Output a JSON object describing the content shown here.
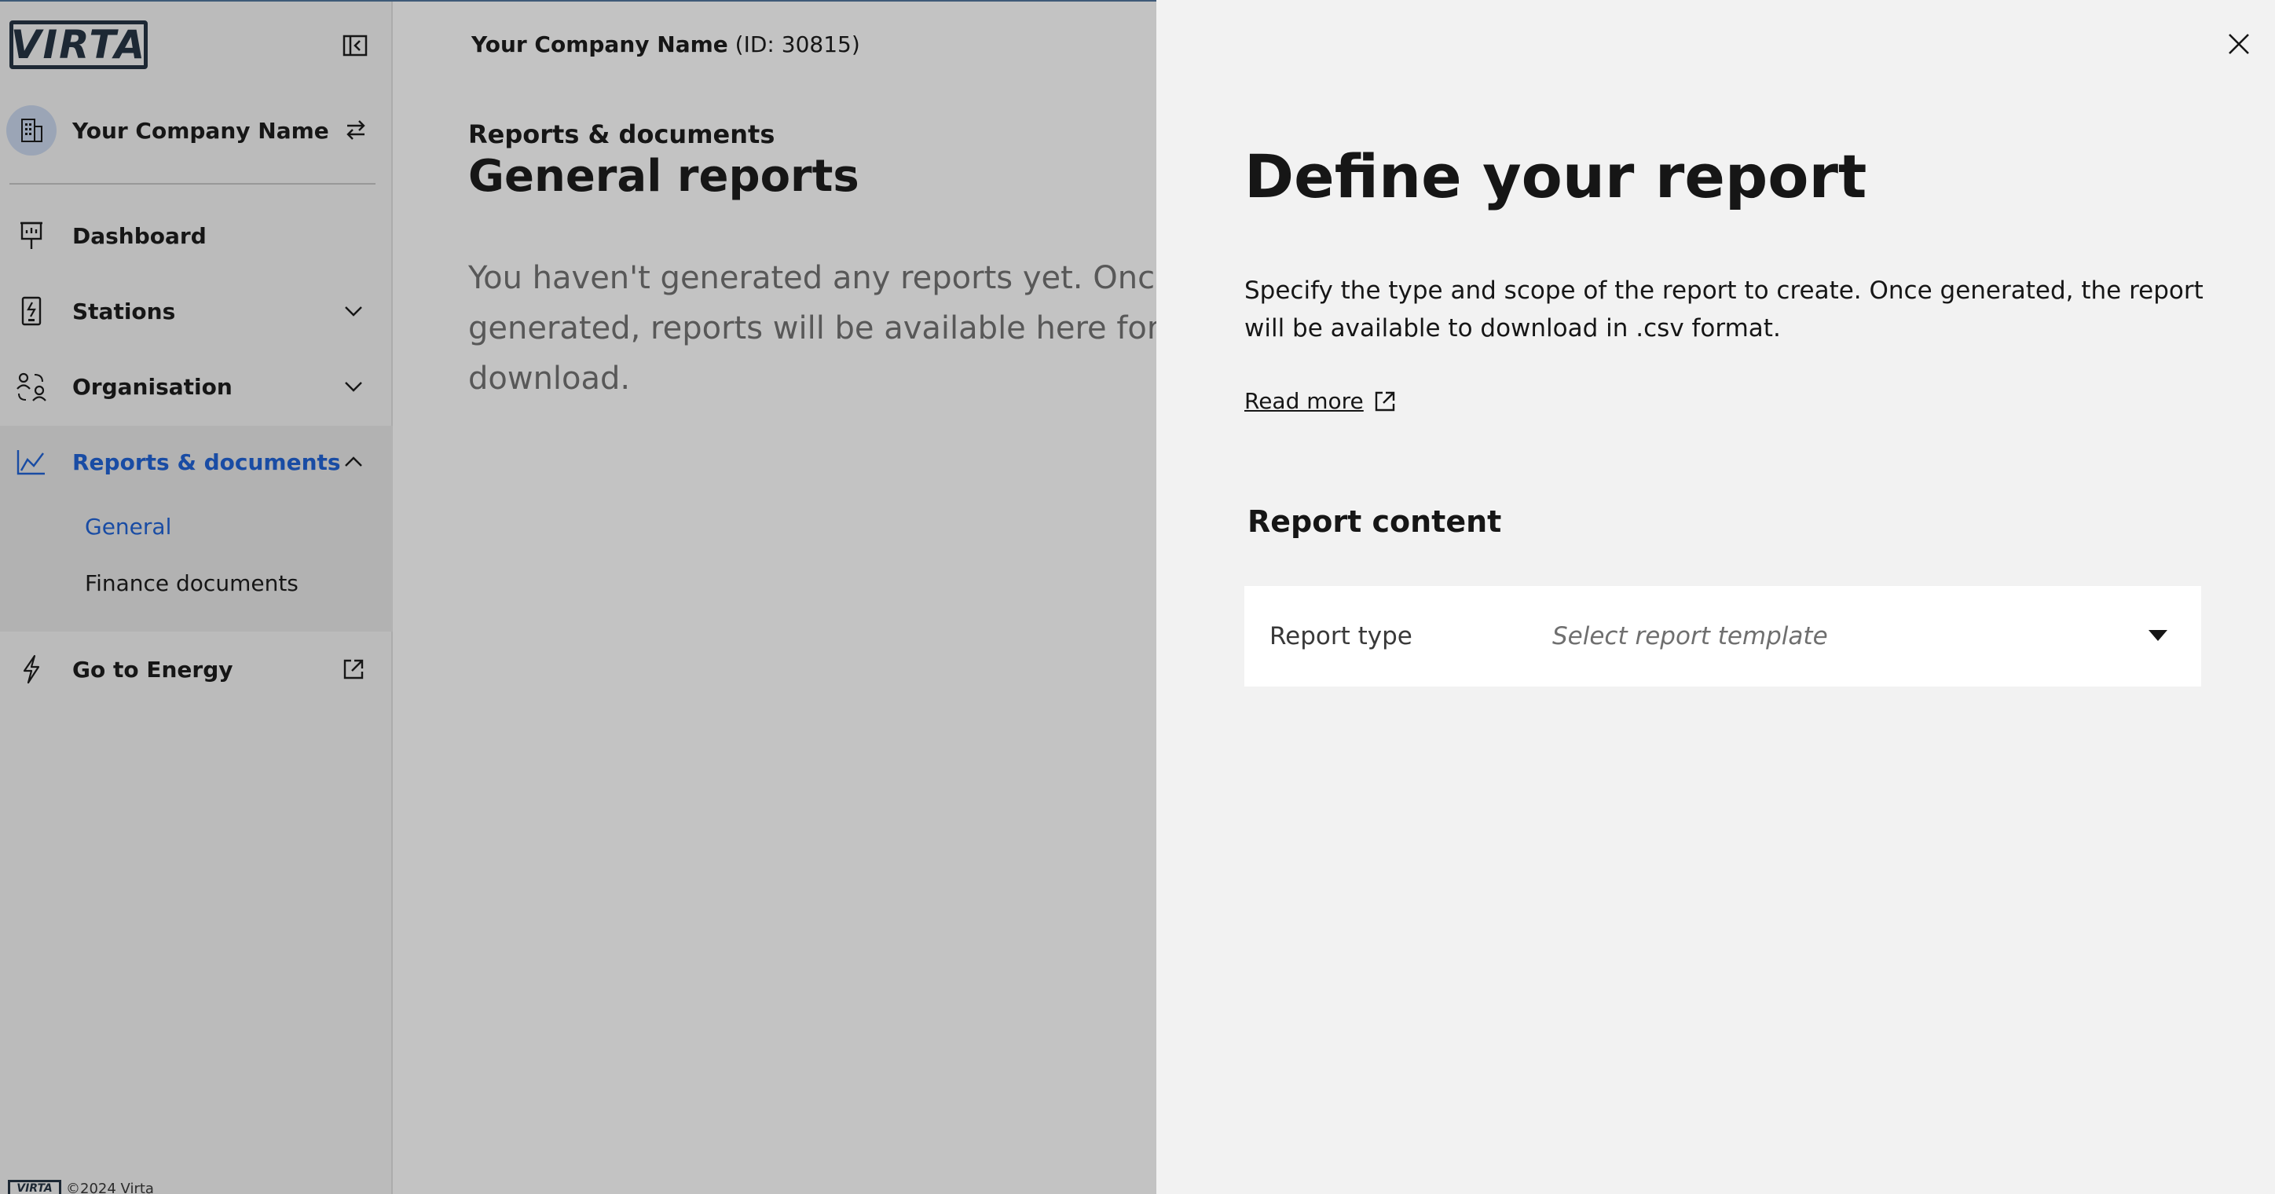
{
  "brand": {
    "logo_text": "VIRTA",
    "footer_text": "©2024 Virta"
  },
  "sidebar": {
    "company_name": "Your Company Name",
    "items": [
      {
        "label": "Dashboard",
        "icon": "presentation-icon"
      },
      {
        "label": "Stations",
        "icon": "charging-station-icon",
        "expandable": true
      },
      {
        "label": "Organisation",
        "icon": "user-exchange-icon",
        "expandable": true
      },
      {
        "label": "Reports & documents",
        "icon": "chart-line-icon",
        "expanded": true,
        "active": true,
        "children": [
          {
            "label": "General",
            "active": true
          },
          {
            "label": "Finance documents"
          }
        ]
      },
      {
        "label": "Go to Energy",
        "icon": "lightning-icon",
        "external": true
      }
    ]
  },
  "header": {
    "company_name": "Your Company Name",
    "company_id": "(ID: 30815)"
  },
  "main": {
    "breadcrumb": "Reports & documents",
    "title": "General reports",
    "empty_message": "You haven't generated any reports yet. Once generated, reports will be available here for you to download."
  },
  "panel": {
    "title": "Define your report",
    "description": "Specify the type and scope of the report to create. Once generated, the report will be available to download in .csv format.",
    "read_more": "Read more",
    "section_title": "Report content",
    "report_type_label": "Report type",
    "report_type_placeholder": "Select report template"
  },
  "colors": {
    "accent": "#1a5fd6",
    "brand_dark": "#1f2f3f",
    "panel_bg": "#f2f2f2"
  }
}
